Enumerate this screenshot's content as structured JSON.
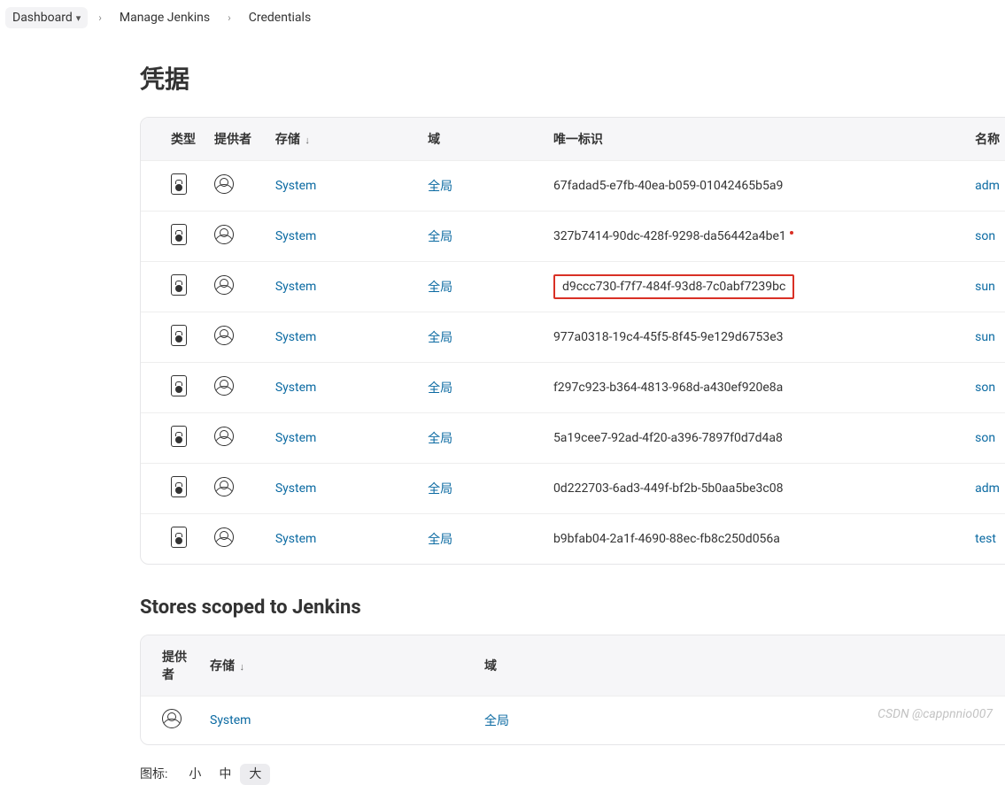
{
  "breadcrumb": {
    "items": [
      "Dashboard",
      "Manage Jenkins",
      "Credentials"
    ]
  },
  "page": {
    "title": "凭据",
    "section_stores_title": "Stores scoped to Jenkins"
  },
  "cred_table": {
    "headers": {
      "type": "类型",
      "provider": "提供者",
      "store": "存储",
      "domain": "域",
      "id": "唯一标识",
      "name": "名称"
    },
    "sort_indicator": "↓",
    "rows": [
      {
        "store": "System",
        "domain": "全局",
        "id": "67fadad5-e7fb-40ea-b059-01042465b5a9",
        "name": "adm",
        "highlight": false,
        "dot": false
      },
      {
        "store": "System",
        "domain": "全局",
        "id": "327b7414-90dc-428f-9298-da56442a4be1",
        "name": "son",
        "highlight": false,
        "dot": true
      },
      {
        "store": "System",
        "domain": "全局",
        "id": "d9ccc730-f7f7-484f-93d8-7c0abf7239bc",
        "name": "sun",
        "highlight": true,
        "dot": false
      },
      {
        "store": "System",
        "domain": "全局",
        "id": "977a0318-19c4-45f5-8f45-9e129d6753e3",
        "name": "sun",
        "highlight": false,
        "dot": false
      },
      {
        "store": "System",
        "domain": "全局",
        "id": "f297c923-b364-4813-968d-a430ef920e8a",
        "name": "son",
        "highlight": false,
        "dot": false
      },
      {
        "store": "System",
        "domain": "全局",
        "id": "5a19cee7-92ad-4f20-a396-7897f0d7d4a8",
        "name": "son",
        "highlight": false,
        "dot": false
      },
      {
        "store": "System",
        "domain": "全局",
        "id": "0d222703-6ad3-449f-bf2b-5b0aa5be3c08",
        "name": "adm",
        "highlight": false,
        "dot": false
      },
      {
        "store": "System",
        "domain": "全局",
        "id": "b9bfab04-2a1f-4690-88ec-fb8c250d056a",
        "name": "test",
        "highlight": false,
        "dot": false
      }
    ]
  },
  "stores_table": {
    "headers": {
      "provider": "提供者",
      "store": "存储",
      "domain": "域"
    },
    "sort_indicator": "↓",
    "rows": [
      {
        "store": "System",
        "domain": "全局"
      }
    ]
  },
  "icon_size": {
    "label": "图标:",
    "options": [
      "小",
      "中",
      "大"
    ],
    "active_index": 2
  },
  "watermark": "CSDN @cappnnio007"
}
